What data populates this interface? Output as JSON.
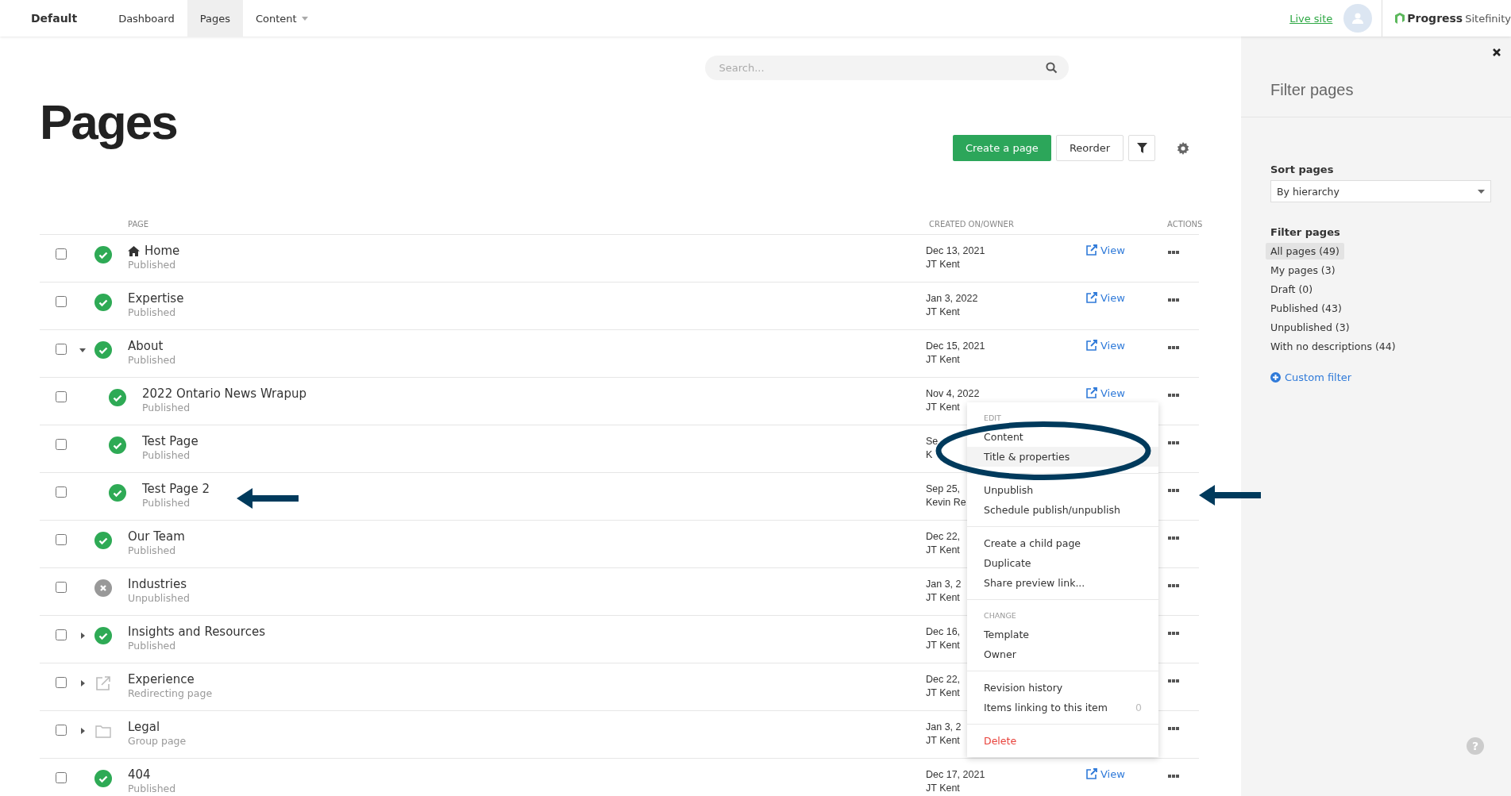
{
  "topbar": {
    "site": "Default",
    "tabs": [
      {
        "label": "Dashboard",
        "selected": false,
        "dropdown": false
      },
      {
        "label": "Pages",
        "selected": true,
        "dropdown": false
      },
      {
        "label": "Content",
        "selected": false,
        "dropdown": true
      }
    ],
    "live_site": "Live site",
    "logo": {
      "brand": "Progress",
      "product": "Sitefinity"
    }
  },
  "search": {
    "placeholder": "Search..."
  },
  "title": "Pages",
  "buttons": {
    "create": "Create a page",
    "reorder": "Reorder"
  },
  "table": {
    "columns": [
      "PAGE",
      "CREATED ON/OWNER",
      "ACTIONS"
    ],
    "rows": [
      {
        "name": "Home",
        "kind": "published",
        "home": true,
        "status": "Published",
        "checked": false,
        "created": "Dec 13, 2021",
        "owner": "JT Kent",
        "view": "View"
      },
      {
        "name": "Expertise",
        "kind": "published",
        "status": "Published",
        "checked": false,
        "created": "Jan 3, 2022",
        "owner": "JT Kent",
        "view": "View"
      },
      {
        "name": "About",
        "kind": "published",
        "status": "Published",
        "checked": false,
        "expanded": true,
        "created": "Dec 15, 2021",
        "owner": "JT Kent",
        "view": "View",
        "children": [
          {
            "name": "2022 Ontario News Wrapup",
            "kind": "published",
            "status": "Published",
            "checked": false,
            "created": "Nov 4, 2022",
            "owner": "JT Kent",
            "view": "View"
          },
          {
            "name": "Test Page",
            "kind": "published",
            "status": "Published",
            "checked": false,
            "created": "Se",
            "owner": "K"
          },
          {
            "name": "Test Page 2",
            "kind": "published",
            "status": "Published",
            "checked": false,
            "created": "Sep 25,",
            "owner": "Kevin Re"
          }
        ]
      },
      {
        "name": "Our Team",
        "kind": "published",
        "status": "Published",
        "checked": false,
        "created": "Dec 22,",
        "owner": "JT Kent"
      },
      {
        "name": "Industries",
        "kind": "unpublished",
        "status": "Unpublished",
        "checked": false,
        "created": "Jan 3, 2",
        "owner": "JT Kent"
      },
      {
        "name": "Insights and Resources",
        "kind": "published",
        "status": "Published",
        "checked": false,
        "expanded": false,
        "created": "Dec 16,",
        "owner": "JT Kent"
      },
      {
        "name": "Experience",
        "kind": "redirect",
        "status": "Redirecting page",
        "checked": false,
        "expanded": false,
        "created": "Dec 22,",
        "owner": "JT Kent"
      },
      {
        "name": "Legal",
        "kind": "group",
        "status": "Group page",
        "checked": false,
        "expanded": false,
        "created": "Jan 3, 2",
        "owner": "JT Kent"
      },
      {
        "name": "404",
        "kind": "published",
        "status": "Published",
        "checked": false,
        "created": "Dec 17, 2021",
        "owner": "JT Kent",
        "view": "View"
      }
    ]
  },
  "menu": {
    "sections": [
      {
        "label": "EDIT",
        "items": [
          {
            "label": "Content",
            "kind": "normal",
            "selected": false
          },
          {
            "label": "Title & properties",
            "kind": "normal",
            "selected": true
          }
        ]
      },
      {
        "items": [
          {
            "label": "Unpublish",
            "kind": "normal",
            "selected": false
          },
          {
            "label": "Schedule publish/unpublish",
            "kind": "normal",
            "selected": false
          }
        ]
      },
      {
        "items": [
          {
            "label": "Create a child page",
            "kind": "normal",
            "selected": false
          },
          {
            "label": "Duplicate",
            "kind": "normal",
            "selected": false
          },
          {
            "label": "Share preview link...",
            "kind": "normal",
            "selected": false
          }
        ]
      },
      {
        "label": "CHANGE",
        "items": [
          {
            "label": "Template",
            "kind": "normal",
            "selected": false
          },
          {
            "label": "Owner",
            "kind": "normal",
            "selected": false
          }
        ]
      },
      {
        "items": [
          {
            "label": "Revision history",
            "kind": "normal",
            "selected": false
          },
          {
            "label": "Items linking to this item",
            "kind": "normal",
            "count": "0",
            "selected": false
          }
        ]
      },
      {
        "items": [
          {
            "label": "Delete",
            "kind": "danger",
            "selected": false
          }
        ]
      }
    ]
  },
  "panel": {
    "title": "Filter pages",
    "sort_label": "Sort pages",
    "sort_value": "By hierarchy",
    "filter_label": "Filter pages",
    "filters": [
      {
        "label": "All pages (49)",
        "selected": true
      },
      {
        "label": "My pages (3)",
        "selected": false
      },
      {
        "label": "Draft (0)",
        "selected": false
      },
      {
        "label": "Published (43)",
        "selected": false
      },
      {
        "label": "Unpublished (3)",
        "selected": false
      },
      {
        "label": "With no descriptions (44)",
        "selected": false
      }
    ],
    "custom_filter": "Custom filter",
    "help": "?"
  }
}
